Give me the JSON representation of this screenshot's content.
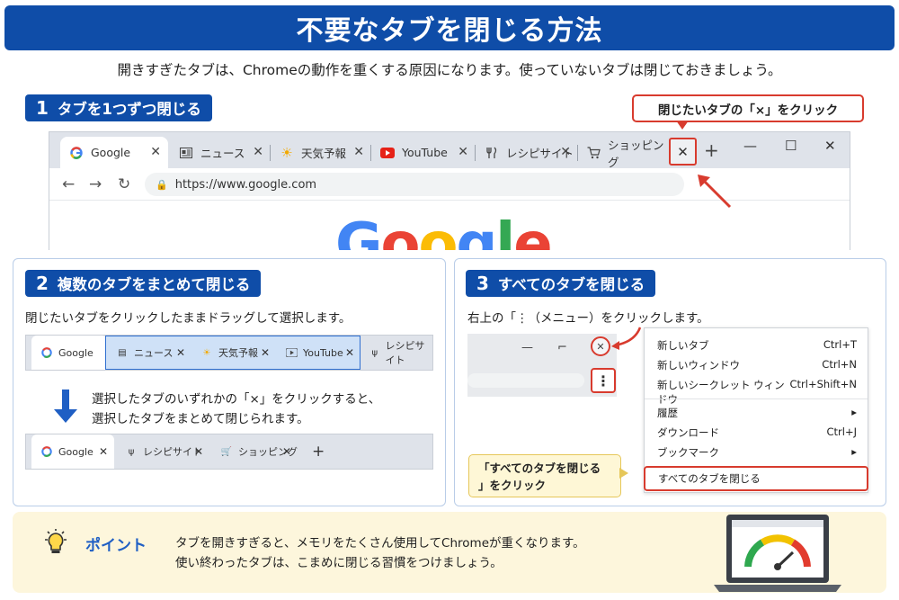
{
  "title": "不要なタブを閉じる方法",
  "intro": "開きすぎたタブは、Chromeの動作を重くする原因になります。使っていないタブは閉じておきましょう。",
  "section1": {
    "num": "1",
    "label": "タブを1つずつ閉じる",
    "callout": "閉じたいタブの「×」をクリック",
    "tabs": [
      "Google",
      "ニュース",
      "天気予報",
      "YouTube",
      "レシピサイト",
      "ショッピング"
    ],
    "url": "https://www.google.com",
    "logo": "Google"
  },
  "section2": {
    "num": "2",
    "label": "複数のタブをまとめて閉じる",
    "desc": "閉じたいタブをクリックしたままドラッグして選択します。",
    "strip1": [
      "Google",
      "ニュース",
      "天気予報",
      "YouTube",
      "レシピサイト"
    ],
    "note1": "選択したタブのいずれかの「×」をクリックすると、",
    "note2": "選択したタブをまとめて閉じられます。",
    "strip2": [
      "Google",
      "レシピサイト",
      "ショッピング"
    ]
  },
  "section3": {
    "num": "3",
    "label": "すべてのタブを閉じる",
    "desc": "右上の「⋮（メニュー）をクリックします。",
    "menu": [
      {
        "label": "新しいタブ",
        "shortcut": "Ctrl+T"
      },
      {
        "label": "新しいウィンドウ",
        "shortcut": "Ctrl+N"
      },
      {
        "label": "新しいシークレット ウィンドウ",
        "shortcut": "Ctrl+Shift+N"
      },
      {
        "label": "履歴",
        "shortcut": "▸"
      },
      {
        "label": "ダウンロード",
        "shortcut": "Ctrl+J"
      },
      {
        "label": "ブックマーク",
        "shortcut": "▸"
      }
    ],
    "close_all": "すべてのタブを閉じる",
    "callout_line1": "「すべてのタブを閉じる",
    "callout_line2": "」をクリック"
  },
  "tip": {
    "title": "ポイント",
    "line1": "タブを開きすぎると、メモリをたくさん使用してChromeが重くなります。",
    "line2": "使い終わったタブは、こまめに閉じる習慣をつけましょう。"
  },
  "colors": {
    "primary": "#0f4da8",
    "highlight": "#d83b2e",
    "tip_bg": "#fdf6dc"
  }
}
